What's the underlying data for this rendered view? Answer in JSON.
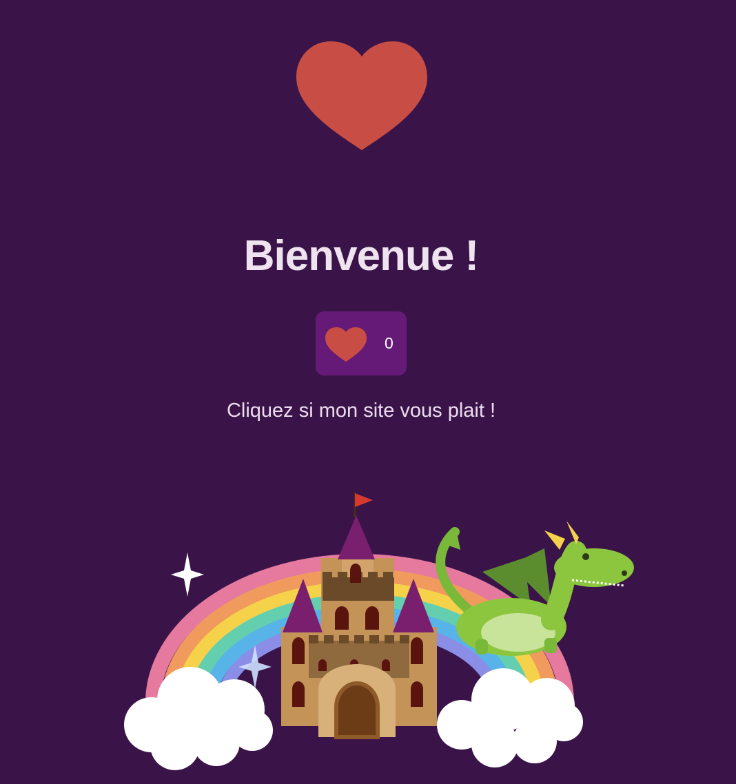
{
  "page": {
    "title": "Bienvenue !",
    "subtitle": "Cliquez si mon site vous plait !"
  },
  "like_button": {
    "count": "0",
    "icon": "heart-icon"
  },
  "hero": {
    "icon": "heart-icon"
  },
  "illustration": {
    "elements": [
      "rainbow",
      "castle",
      "dragon",
      "clouds",
      "sparkles",
      "flag"
    ]
  },
  "colors": {
    "background": "#3a1449",
    "heart": "#c84e45",
    "button": "#661a78",
    "title": "#eee3ef"
  }
}
